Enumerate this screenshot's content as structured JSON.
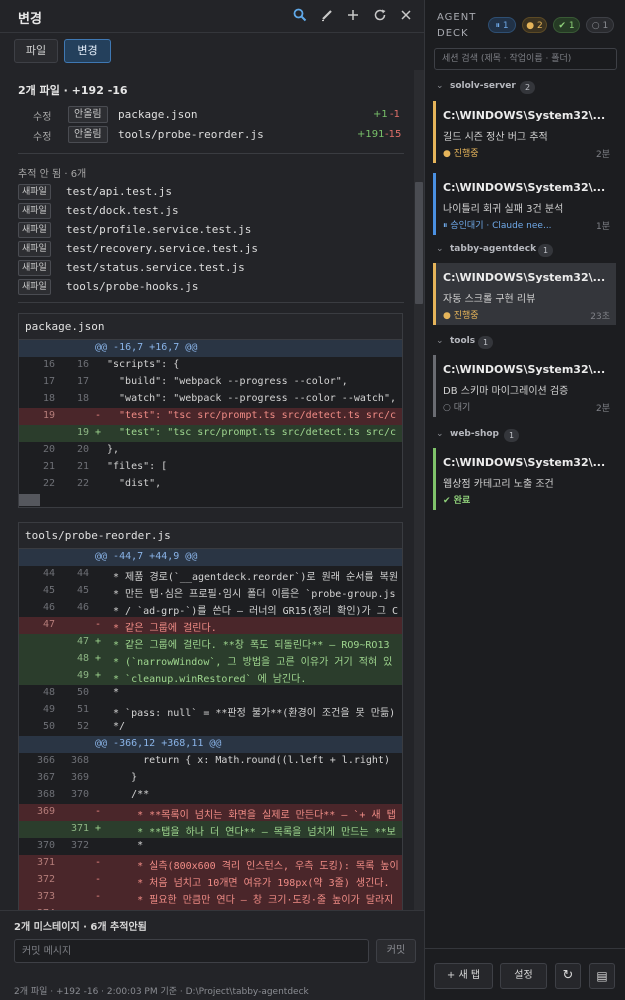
{
  "panel": {
    "title": "변경",
    "tabs": [
      "파일",
      "변경"
    ],
    "summary": "2개 파일 · +192 -16",
    "modified_files": [
      {
        "status": "수정",
        "badge": "안올림",
        "name": "package.json",
        "add": "+1",
        "del": "-1"
      },
      {
        "status": "수정",
        "badge": "안올림",
        "name": "tools/probe-reorder.js",
        "add": "+191",
        "del": "-15"
      }
    ],
    "untracked_title": "추적 안 됨 · 6개",
    "untracked": [
      {
        "badge": "새파일",
        "name": "test/api.test.js"
      },
      {
        "badge": "새파일",
        "name": "test/dock.test.js"
      },
      {
        "badge": "새파일",
        "name": "test/profile.service.test.js"
      },
      {
        "badge": "새파일",
        "name": "test/recovery.service.test.js"
      },
      {
        "badge": "새파일",
        "name": "test/status.service.test.js"
      },
      {
        "badge": "새파일",
        "name": "tools/probe-hooks.js"
      }
    ],
    "diffs": [
      {
        "file": "package.json",
        "lines": [
          {
            "t": "hunk",
            "o": "",
            "n": "",
            "s": "",
            "c": "@@ -16,7 +16,7 @@"
          },
          {
            "t": "ctx",
            "o": "16",
            "n": "16",
            "s": "",
            "c": "\"scripts\": {"
          },
          {
            "t": "ctx",
            "o": "17",
            "n": "17",
            "s": "",
            "c": "  \"build\": \"webpack --progress --color\","
          },
          {
            "t": "ctx",
            "o": "18",
            "n": "18",
            "s": "",
            "c": "  \"watch\": \"webpack --progress --color --watch\","
          },
          {
            "t": "del",
            "o": "19",
            "n": "",
            "s": "-",
            "c": "  \"test\": \"tsc src/prompt.ts src/detect.ts src/c"
          },
          {
            "t": "add",
            "o": "",
            "n": "19",
            "s": "+",
            "c": "  \"test\": \"tsc src/prompt.ts src/detect.ts src/c"
          },
          {
            "t": "ctx",
            "o": "20",
            "n": "20",
            "s": "",
            "c": "},"
          },
          {
            "t": "ctx",
            "o": "21",
            "n": "21",
            "s": "",
            "c": "\"files\": ["
          },
          {
            "t": "ctx",
            "o": "22",
            "n": "22",
            "s": "",
            "c": "  \"dist\","
          }
        ]
      },
      {
        "file": "tools/probe-reorder.js",
        "lines": [
          {
            "t": "hunk",
            "o": "",
            "n": "",
            "s": "",
            "c": "@@ -44,7 +44,9 @@"
          },
          {
            "t": "ctx",
            "o": "44",
            "n": "44",
            "s": "",
            "c": " * 제품 경로(`__agentdeck.reorder`)로 원래 순서를 복원"
          },
          {
            "t": "ctx",
            "o": "45",
            "n": "45",
            "s": "",
            "c": " * 만든 탭·심은 프로필·임시 폴더 이름은 `probe-group.js"
          },
          {
            "t": "ctx",
            "o": "46",
            "n": "46",
            "s": "",
            "c": " * / `ad-grp-`)를 쓴다 — 러너의 GR15(정리 확인)가 그 C"
          },
          {
            "t": "del",
            "o": "47",
            "n": "",
            "s": "-",
            "c": " * 같은 그룹에 걸린다."
          },
          {
            "t": "add",
            "o": "",
            "n": "47",
            "s": "+",
            "c": " * 같은 그룹에 걸린다. **창 폭도 되돌린다** — RO9~RO13"
          },
          {
            "t": "add",
            "o": "",
            "n": "48",
            "s": "+",
            "c": " * (`narrowWindow`, 그 방법을 고른 이유가 거기 적혀 있"
          },
          {
            "t": "add",
            "o": "",
            "n": "49",
            "s": "+",
            "c": " * `cleanup.winRestored` 에 남긴다."
          },
          {
            "t": "ctx",
            "o": "48",
            "n": "50",
            "s": "",
            "c": " *"
          },
          {
            "t": "ctx",
            "o": "49",
            "n": "51",
            "s": "",
            "c": " * `pass: null` = **판정 불가**(환경이 조건을 못 만듦)"
          },
          {
            "t": "ctx",
            "o": "50",
            "n": "52",
            "s": "",
            "c": " */"
          },
          {
            "t": "hunk",
            "o": "",
            "n": "",
            "s": "",
            "c": "@@ -366,12 +368,11 @@"
          },
          {
            "t": "ctx",
            "o": "366",
            "n": "368",
            "s": "",
            "c": "      return { x: Math.round((l.left + l.right)"
          },
          {
            "t": "ctx",
            "o": "367",
            "n": "369",
            "s": "",
            "c": "    }"
          },
          {
            "t": "ctx",
            "o": "368",
            "n": "370",
            "s": "",
            "c": "    /**"
          },
          {
            "t": "del",
            "o": "369",
            "n": "",
            "s": "-",
            "c": "     * **목록이 넘치는 화면을 실제로 만든다** — `+ 새 탭"
          },
          {
            "t": "add",
            "o": "",
            "n": "371",
            "s": "+",
            "c": "     * **탭을 하나 더 연다** — 목록을 넘치게 만드는 **보"
          },
          {
            "t": "ctx",
            "o": "370",
            "n": "372",
            "s": "",
            "c": "     *"
          },
          {
            "t": "del",
            "o": "371",
            "n": "",
            "s": "-",
            "c": "     * 실측(800x600 격리 인스턴스, 우측 도킹): 목록 높이"
          },
          {
            "t": "del",
            "o": "372",
            "n": "",
            "s": "-",
            "c": "     * 처음 넘치고 10개면 여유가 198px(약 3줄) 생긴다."
          },
          {
            "t": "del",
            "o": "373",
            "n": "",
            "s": "-",
            "c": "     * 필요한 만큼만 연다 — 창 크기·도킹·줄 높이가 달라지"
          },
          {
            "t": "del",
            "o": "374",
            "n": "",
            "s": "-",
            "c": "     * 더 만들면 그 사이로 그대로 들어지는 (충분하게)"
          }
        ]
      }
    ],
    "footer": {
      "title": "2개 미스테이지 · 6개 추적안됨",
      "commit_placeholder": "커밋 메시지",
      "commit_button": "커밋",
      "status": "2개 파일 · +192 -16 · 2:00:03 PM 기준 · D:\\Project\\tabby-agentdeck"
    }
  },
  "deck": {
    "title": "AGENT DECK",
    "pills": [
      {
        "icon": "pause-icon",
        "text": "⏸ 1",
        "color": "#4a90e2"
      },
      {
        "icon": "dot-icon",
        "text": "● 2",
        "color": "#e5b45a"
      },
      {
        "icon": "check-icon",
        "text": "✔ 1",
        "color": "#7fc36a"
      },
      {
        "icon": "idle-icon",
        "text": "○ 1",
        "color": "#8a8c92"
      }
    ],
    "search_placeholder": "세션 검색 (제목 · 작업이름 · 폴더)",
    "groups": [
      {
        "name": "sololv-server",
        "count": "2",
        "sessions": [
          {
            "title": "C:\\WINDOWS\\System32\\...",
            "desc": "길드 시즌 정산 버그 추적",
            "status": "● 진행중",
            "time": "2분",
            "color": "#e5b45a",
            "selected": false
          },
          {
            "title": "C:\\WINDOWS\\System32\\...",
            "desc": "나이틀리 회귀 실패 3건 분석",
            "status": "⏸ 승인대기 · Claude nee...",
            "time": "1분",
            "color": "#4a90e2",
            "selected": false
          }
        ]
      },
      {
        "name": "tabby-agentdeck",
        "count": "1",
        "sessions": [
          {
            "title": "C:\\WINDOWS\\System32\\...",
            "desc": "자동 스크롤 구현 리뷰",
            "status": "● 진행중",
            "time": "23초",
            "color": "#e5b45a",
            "selected": true
          }
        ]
      },
      {
        "name": "tools",
        "count": "1",
        "sessions": [
          {
            "title": "C:\\WINDOWS\\System32\\...",
            "desc": "DB 스키마 마이그레이션 검증",
            "status": "○ 대기",
            "time": "2분",
            "color": "#8a8c92",
            "selected": false
          }
        ]
      },
      {
        "name": "web-shop",
        "count": "1",
        "sessions": [
          {
            "title": "C:\\WINDOWS\\System32\\...",
            "desc": "웹상점 카테고리 노출 조건",
            "status": "✔ 완료",
            "time": "",
            "color": "#7fc36a",
            "selected": false
          }
        ]
      }
    ],
    "buttons": {
      "new_tab": "+ 새 탭",
      "settings": "설정",
      "refresh_icon": "↻",
      "menu_icon": "▤"
    }
  },
  "colors": {
    "accent": "#3f78b3",
    "add": "#79c26a",
    "del": "#e0706a"
  }
}
